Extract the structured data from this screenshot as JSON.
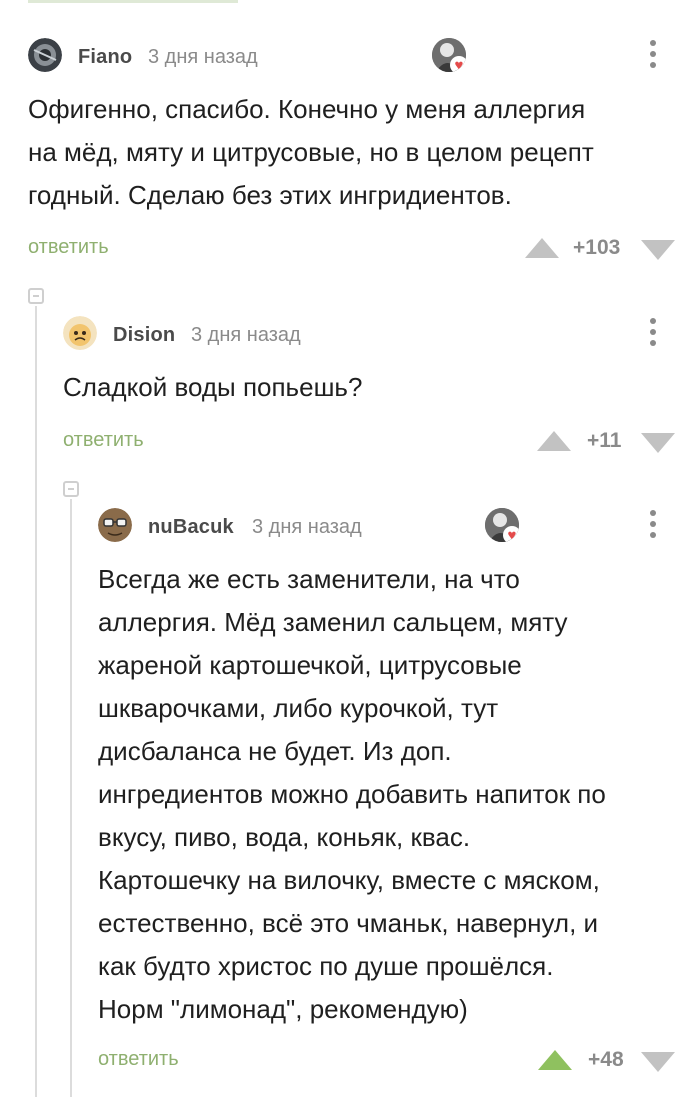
{
  "comments": [
    {
      "author": "Fiano",
      "time": "3 дня назад",
      "text": "Офигенно, спасибо. Конечно у меня аллергия\nна мёд, мяту и цитрусовые, но в целом рецепт\nгодный. Сделаю без этих ингридиентов.",
      "reply": "ответить",
      "score": "+103"
    },
    {
      "author": "Dision",
      "time": "3 дня назад",
      "text": "Сладкой воды попьешь?",
      "reply": "ответить",
      "score": "+11"
    },
    {
      "author": "nuBacuk",
      "time": "3 дня назад",
      "text": "Всегда же есть заменители, на что\nаллергия. Мёд заменил сальцем, мяту\nжареной картошечкой, цитрусовые\nшкварочками, либо курочкой, тут\nдисбаланса не будет. Из доп.\nингредиентов можно добавить напиток по\nвкусу, пиво, вода, коньяк, квас.\nКартошечку на вилочку, вместе с мяском,\nестественно, всё это чманьк, навернул, и\nкак будто христос по душе прошёлся.\nНорм \"лимонад\", рекомендую)",
      "reply": "ответить",
      "score": "+48"
    }
  ],
  "colors": {
    "reply_link": "#8fb070",
    "upvoted": "#8fc15f",
    "vote_idle": "#c2c2c2",
    "heart": "#e44b4b"
  },
  "icons": {
    "more": "more-vertical-icon",
    "upvote": "arrow-up-icon",
    "downvote": "arrow-down-icon",
    "collapse": "collapse-minus-icon",
    "rating": "heart-badge-icon"
  }
}
